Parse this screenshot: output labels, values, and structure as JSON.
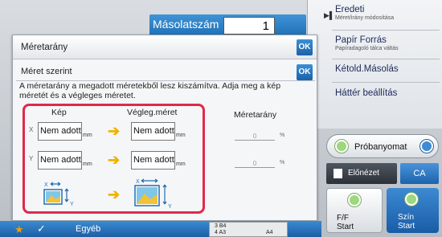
{
  "copies": {
    "label": "Másolatszám",
    "value": "1"
  },
  "right_menu": [
    {
      "main": "Eredeti",
      "sub": "Méret/irány módosítása"
    },
    {
      "main": "Papír Forrás",
      "sub": "Papíradagoló tálca váltás"
    },
    {
      "main": "Kétold.Másolás",
      "sub": ""
    },
    {
      "main": "Háttér beállítás",
      "sub": ""
    }
  ],
  "dialog": {
    "title": "Méretarány",
    "ok_label": "OK",
    "sub_title": "Méret szerint",
    "sub_ok_label": "OK",
    "description": "A méretarány a megadott méretekből lesz kiszámítva. Adja meg a kép méretét és a végleges méretet."
  },
  "size_table": {
    "col_image": "Kép",
    "col_final": "Végleg.méret",
    "axis_x": "X",
    "axis_y": "Y",
    "unit": "mm",
    "x_image": "Nem adott",
    "x_final": "Nem adott",
    "y_image": "Nem adott",
    "y_final": "Nem adott"
  },
  "ratio": {
    "header": "Méretarány",
    "x_value": "0",
    "y_value": "0",
    "unit": "%"
  },
  "buttons": {
    "proof": "Próbanyomat",
    "preview": "Előnézet",
    "ca": "CA",
    "bw_start_1": "F/F",
    "bw_start_2": "Start",
    "color_start_1": "Szín",
    "color_start_2": "Start"
  },
  "bottom": {
    "other": "Egyéb",
    "tray_rows": [
      "3  B4",
      "4  A3"
    ],
    "tray_extra": "A4"
  },
  "colors": {
    "accent": "#1e6fb5",
    "highlight_frame": "#e0294a",
    "arrow": "#f0b400"
  }
}
